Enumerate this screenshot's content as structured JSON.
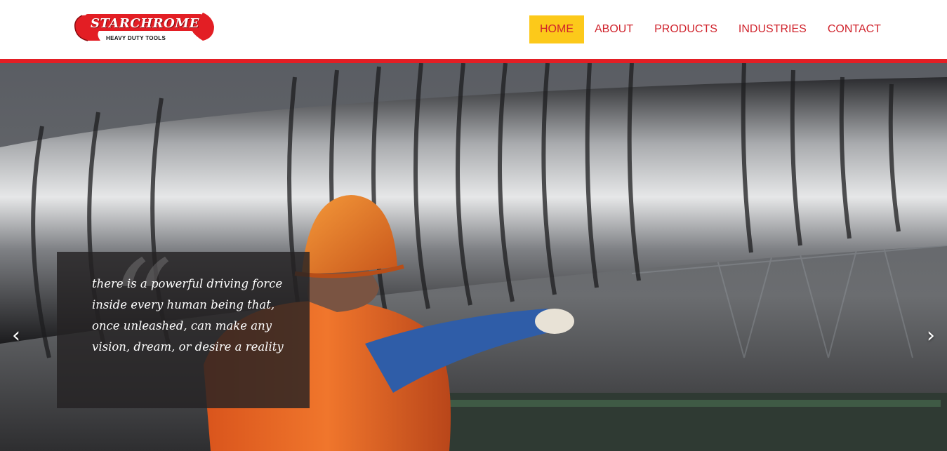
{
  "brand": {
    "name": "STARCHROME",
    "tagline": "HEAVY DUTY TOOLS",
    "colors": {
      "red": "#e31e24",
      "nav_red": "#d0232c",
      "highlight": "#fcc91a"
    }
  },
  "nav": {
    "items": [
      {
        "label": "HOME",
        "active": true
      },
      {
        "label": "ABOUT",
        "active": false
      },
      {
        "label": "PRODUCTS",
        "active": false
      },
      {
        "label": "INDUSTRIES",
        "active": false
      },
      {
        "label": "CONTACT",
        "active": false
      }
    ]
  },
  "hero": {
    "quote_mark": "“",
    "quote": "there is a powerful driving force inside every human being that, once unleashed, can make any vision, dream, or desire a reality",
    "prev_icon": "chevron-left-icon",
    "next_icon": "chevron-right-icon",
    "prev_glyph": "‹",
    "next_glyph": "›"
  }
}
